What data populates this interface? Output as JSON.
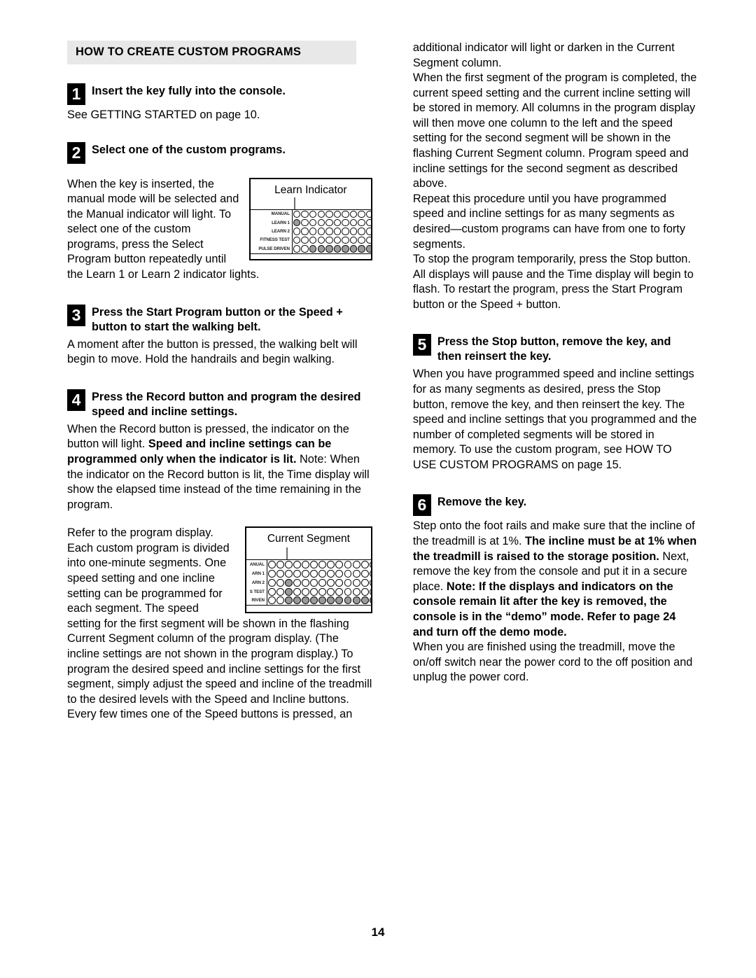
{
  "document": {
    "page_number": "14",
    "section_heading": "HOW TO CREATE CUSTOM PROGRAMS"
  },
  "left_column": {
    "step1": {
      "number": "1",
      "title": "Insert the key fully into the console.",
      "body": "See GETTING STARTED on page 10."
    },
    "step2": {
      "number": "2",
      "title": "Select one of the custom programs.",
      "body": "When the key is inserted, the manual mode will be selected and the Manual indicator will light. To select one of the custom programs, press the Select Program button repeatedly until the Learn 1 or Learn 2 indicator lights."
    },
    "step3": {
      "number": "3",
      "title": "Press the Start Program button or the Speed + button to start the walking belt.",
      "body": "A moment after the button is pressed, the walking belt will begin to move. Hold the handrails and begin walking."
    },
    "step4": {
      "number": "4",
      "title": "Press the Record button and program the desired speed and incline settings.",
      "body_part1": "When the Record button is pressed, the indicator on the button will light. ",
      "body_bold1": "Speed and incline settings can be programmed only when the indicator is lit.",
      "body_part2": " Note: When the indicator on the Record button is lit, the Time display will show the elapsed time instead of the time remaining in the program.",
      "body2": "Refer to the program display. Each custom program is divided into one-minute segments. One speed setting and one incline setting can be programmed for each segment. The speed setting for the first segment will be shown in the flashing Current Segment column of the program display. (The incline settings are not shown in the program display.) To program the desired speed and incline settings for the first segment, simply adjust the speed and incline of the treadmill to the desired levels with the Speed and Incline buttons. Every few times one of the Speed buttons is pressed, an"
    }
  },
  "right_column": {
    "para1": "additional indicator will light or darken in the Current Segment column.",
    "para2": "When the first segment of the program is completed, the current speed setting and the current incline setting will be stored in memory. All columns in the program display will then move one column to the left and the speed setting for the second segment will be shown in the flashing Current Segment column. Program speed and incline settings for the second segment as described above.",
    "para3": "Repeat this procedure until you have programmed speed and incline settings for as many segments as desired—custom programs can have from one to forty segments.",
    "para4": "To stop the program temporarily, press the Stop button. All displays will pause and the Time display will begin to flash. To restart the program, press the Start Program button or the Speed + button.",
    "step5": {
      "number": "5",
      "title": "Press the Stop button, remove the key, and then reinsert the key.",
      "body": "When you have programmed speed and incline settings for as many segments as desired, press the Stop button, remove the key, and then reinsert the key. The speed and incline settings that you programmed and the number of completed segments will be stored in memory. To use the custom program, see HOW TO USE CUSTOM PROGRAMS on page 15."
    },
    "step6": {
      "number": "6",
      "title": "Remove the key.",
      "body_part1": "Step onto the foot rails and make sure that the incline of the treadmill is at 1%. ",
      "body_bold1": "The incline must be at 1% when the treadmill is raised to the storage position.",
      "body_part2": " Next, remove the key from the console and put it in a secure place. ",
      "body_bold2": "Note: If the displays and indicators on the console remain lit after the key is removed, the console is in the “demo” mode. Refer to page 24 and turn off the demo mode.",
      "body2": "When you are finished using the treadmill, move the on/off switch near the power cord to the off position and unplug the power cord."
    }
  },
  "figures": {
    "learn_indicator": {
      "caption": "Learn Indicator",
      "row_labels": [
        "MANUAL",
        "LEARN 1",
        "LEARN 2",
        "FITNESS TEST",
        "PULSE DRIVEN"
      ],
      "columns": 10,
      "lit": {
        "MANUAL": [],
        "LEARN 1": [
          1
        ],
        "LEARN 2": [],
        "FITNESS TEST": [],
        "PULSE DRIVEN": [
          3,
          4,
          5,
          6,
          7,
          8,
          9,
          10
        ]
      },
      "callout_column": 1
    },
    "current_segment": {
      "caption": "Current Segment",
      "row_labels": [
        "ANUAL",
        "ARN 1",
        "ARN 2",
        "S TEST",
        "RIVEN"
      ],
      "columns": 13,
      "lit": {
        "ANUAL": [],
        "ARN 1": [],
        "ARN 2": [
          3
        ],
        "S TEST": [
          3
        ],
        "RIVEN": [
          3,
          4,
          5,
          6,
          7,
          8,
          9,
          10,
          11,
          12,
          13
        ]
      },
      "callout_column": 3
    }
  }
}
